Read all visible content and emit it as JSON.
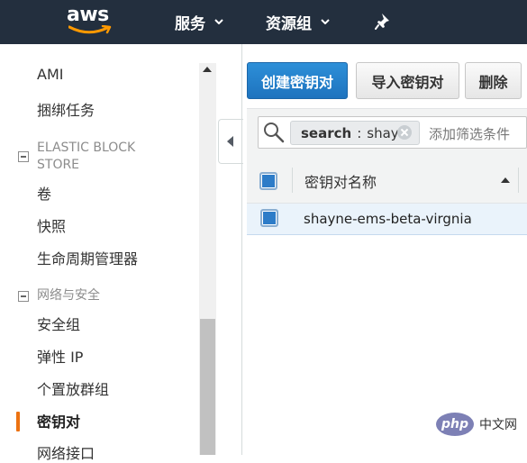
{
  "header": {
    "logo_text": "aws",
    "nav": [
      {
        "label": "服务"
      },
      {
        "label": "资源组"
      }
    ],
    "colors": {
      "bar": "#232f3e",
      "accent": "#ff9900"
    }
  },
  "sidebar": {
    "items_top": [
      {
        "label": "AMI"
      },
      {
        "label": "捆绑任务"
      }
    ],
    "sections": [
      {
        "title_line1": "ELASTIC BLOCK",
        "title_line2": "STORE",
        "items": [
          {
            "label": "卷"
          },
          {
            "label": "快照"
          },
          {
            "label": "生命周期管理器"
          }
        ]
      },
      {
        "title_line1": "网络与安全",
        "items": [
          {
            "label": "安全组"
          },
          {
            "label": "弹性 IP"
          },
          {
            "label": "个置放群组"
          },
          {
            "label": "密钥对",
            "active": true
          },
          {
            "label": "网络接口"
          }
        ]
      }
    ],
    "active_color": "#ec7211"
  },
  "toolbar": {
    "create_label": "创建密钥对",
    "import_label": "导入密钥对",
    "delete_label": "删除"
  },
  "filter": {
    "token_key": "search",
    "token_sep": ":",
    "token_value": "shay",
    "placeholder": "添加筛选条件"
  },
  "table": {
    "columns": [
      {
        "label": "密钥对名称"
      }
    ],
    "rows": [
      {
        "name": "shayne-ems-beta-virgnia",
        "selected": true
      }
    ]
  },
  "watermark": {
    "logo": "php",
    "text": "中文网"
  }
}
